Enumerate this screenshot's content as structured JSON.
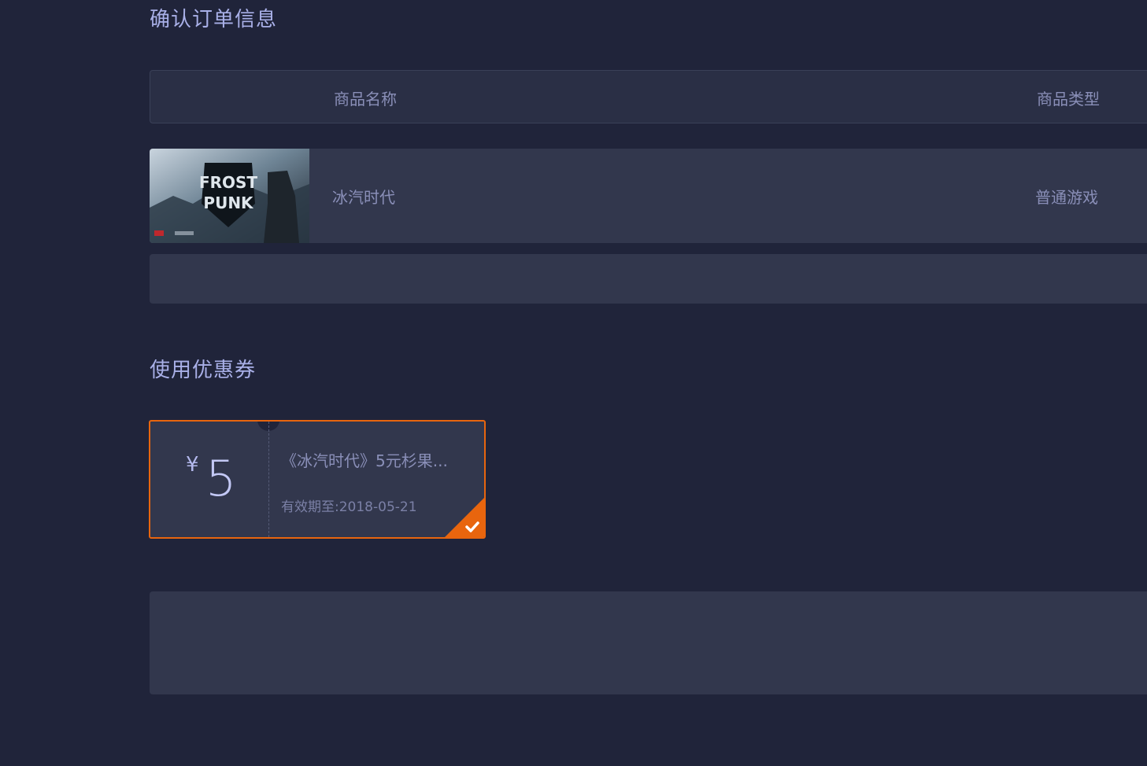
{
  "confirm_section": {
    "title": "确认订单信息"
  },
  "table_header": {
    "col_name": "商品名称",
    "col_type": "商品类型"
  },
  "product": {
    "name": "冰汽时代",
    "type": "普通游戏",
    "cover_icon": "frostpunk-cover-image"
  },
  "coupon_section": {
    "title": "使用优惠券"
  },
  "coupon": {
    "currency": "¥",
    "amount": "5",
    "title": "《冰汽时代》5元杉果...",
    "expire": "有效期至:2018-05-21",
    "selected": true,
    "accent_color": "#e8650e"
  },
  "colors": {
    "background": "#20243a",
    "panel": "#32374d",
    "heading": "#a9b0e8",
    "text": "#8a8fb8"
  }
}
